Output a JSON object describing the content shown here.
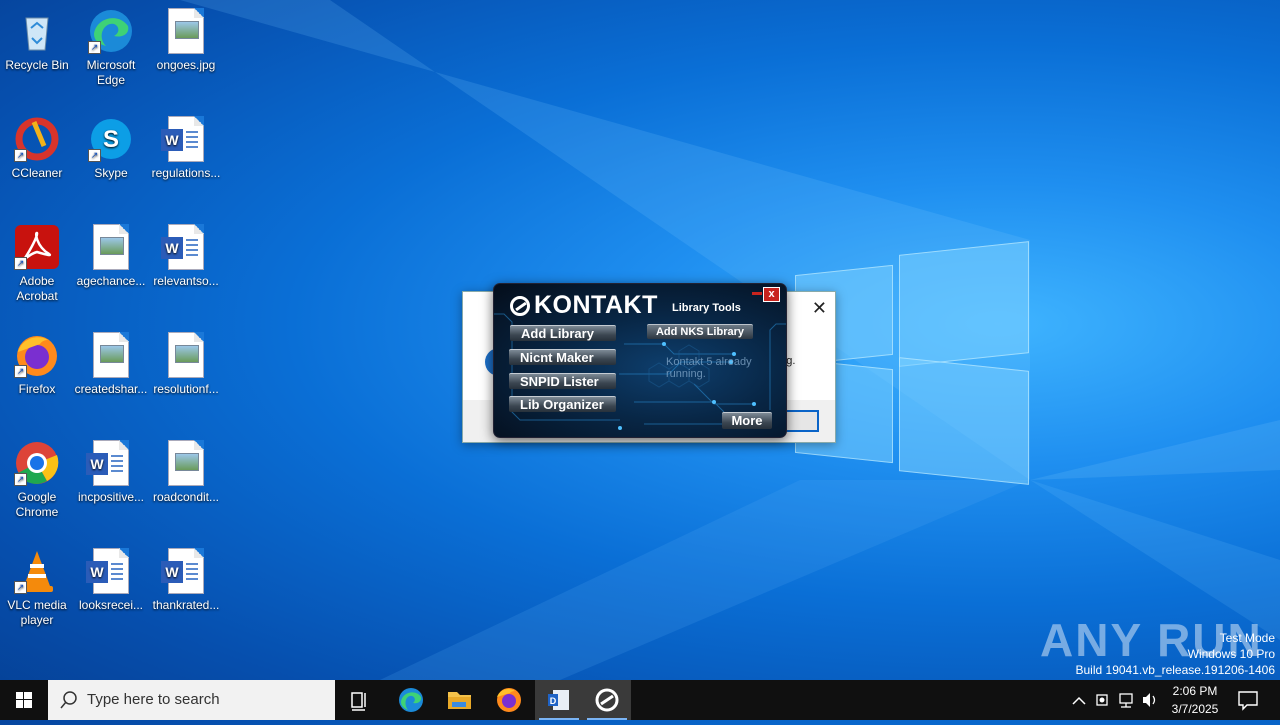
{
  "desktop": {
    "icons": [
      {
        "label": "Recycle Bin",
        "icon": "recycle-bin-icon"
      },
      {
        "label": "Microsoft Edge",
        "icon": "edge-icon"
      },
      {
        "label": "ongoes.jpg",
        "icon": "image-file-icon"
      },
      {
        "label": "CCleaner",
        "icon": "ccleaner-icon"
      },
      {
        "label": "Skype",
        "icon": "skype-icon"
      },
      {
        "label": "regulations...",
        "icon": "word-doc-icon"
      },
      {
        "label": "Adobe Acrobat",
        "icon": "acrobat-icon"
      },
      {
        "label": "agechance...",
        "icon": "image-file-icon"
      },
      {
        "label": "relevantso...",
        "icon": "word-doc-icon"
      },
      {
        "label": "Firefox",
        "icon": "firefox-icon"
      },
      {
        "label": "createdshar...",
        "icon": "image-file-icon"
      },
      {
        "label": "resolutionf...",
        "icon": "image-file-icon"
      },
      {
        "label": "Google Chrome",
        "icon": "chrome-icon"
      },
      {
        "label": "incpositive...",
        "icon": "word-doc-icon"
      },
      {
        "label": "roadcondit...",
        "icon": "image-file-icon"
      },
      {
        "label": "VLC media player",
        "icon": "vlc-icon"
      },
      {
        "label": "looksrecei...",
        "icon": "word-doc-icon"
      },
      {
        "label": "thankrated...",
        "icon": "word-doc-icon"
      }
    ]
  },
  "message_box": {
    "text": "Kontakt 5 already running."
  },
  "kontakt": {
    "title": "KONTAKT",
    "subtitle": "Library Tools",
    "close_label": "x",
    "buttons": [
      "Add Library",
      "Nicnt Maker",
      "SNPID Lister",
      "Lib Organizer"
    ],
    "nks_label": "Add NKS Library",
    "more_label": "More"
  },
  "watermark": {
    "brand": "ANY RUN",
    "line1": "Test Mode",
    "line2": "Windows 10 Pro",
    "line3": "Build 19041.vb_release.191206-1406"
  },
  "taskbar": {
    "search_placeholder": "Type here to search",
    "time": "2:06 PM",
    "date": "3/7/2025",
    "colors": {
      "accent": "#7ab4f5",
      "bar": "#101010"
    }
  }
}
